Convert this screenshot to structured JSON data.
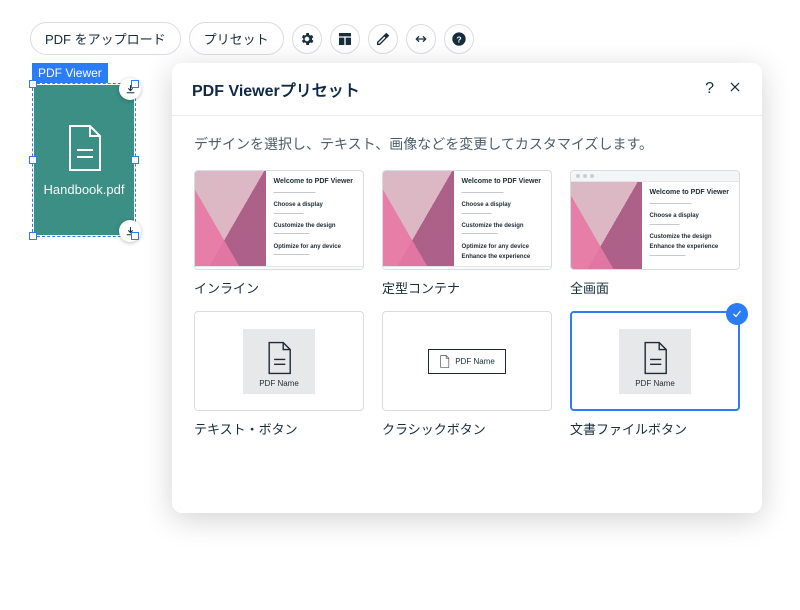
{
  "toolbar": {
    "upload": "PDF をアップロード",
    "presets": "プリセット"
  },
  "widget": {
    "label": "PDF Viewer",
    "filename": "Handbook.pdf"
  },
  "panel": {
    "title": "PDF Viewerプリセット",
    "desc": "デザインを選択し、テキスト、画像などを変更してカスタマイズします。",
    "preview": {
      "heading": "Welcome to PDF Viewer",
      "sub1": "Choose a display",
      "sub2": "Customize the design",
      "sub3": "Optimize for any device",
      "sub4": "Enhance the experience"
    },
    "pdfname": "PDF Name",
    "options": [
      {
        "label": "インライン",
        "type": "inline",
        "selected": false
      },
      {
        "label": "定型コンテナ",
        "type": "container",
        "selected": false
      },
      {
        "label": "全画面",
        "type": "fullscreen",
        "selected": false
      },
      {
        "label": "テキスト・ボタン",
        "type": "textbtn",
        "selected": false
      },
      {
        "label": "クラシックボタン",
        "type": "classicbtn",
        "selected": false
      },
      {
        "label": "文書ファイルボタン",
        "type": "docbtn",
        "selected": true
      }
    ]
  }
}
